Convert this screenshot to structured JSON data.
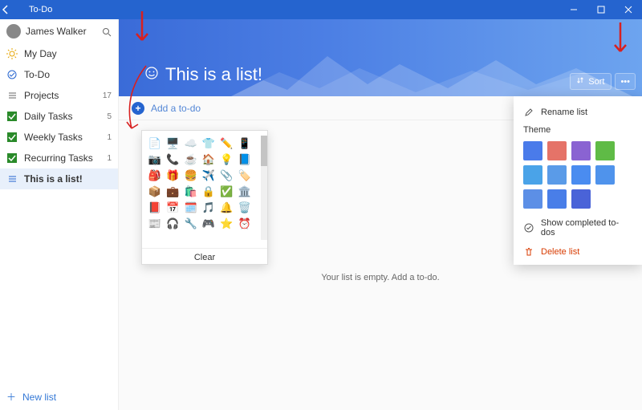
{
  "titlebar": {
    "title": "To-Do"
  },
  "profile": {
    "name": "James Walker"
  },
  "sidebar": {
    "items": [
      {
        "label": "My Day",
        "count": "",
        "kind": "myday"
      },
      {
        "label": "To-Do",
        "count": "",
        "kind": "todo"
      },
      {
        "label": "Projects",
        "count": "17",
        "kind": "list"
      },
      {
        "label": "Daily Tasks",
        "count": "5",
        "kind": "check"
      },
      {
        "label": "Weekly Tasks",
        "count": "1",
        "kind": "check"
      },
      {
        "label": "Recurring Tasks",
        "count": "1",
        "kind": "check"
      },
      {
        "label": "This is a list!",
        "count": "",
        "kind": "selected"
      }
    ],
    "new_list": "New list"
  },
  "hero": {
    "list_name": "This is a list!",
    "sort_label": "Sort"
  },
  "add": {
    "placeholder": "Add a to-do"
  },
  "empty": {
    "message": "Your list is empty. Add a to-do."
  },
  "emoji_popup": {
    "clear_label": "Clear"
  },
  "ctxmenu": {
    "rename": "Rename list",
    "theme": "Theme",
    "show_completed": "Show completed to-dos",
    "delete": "Delete list",
    "swatch_colors": [
      "#4a7bea",
      "#e57368",
      "#8a63d2",
      "#5fbb46",
      "#4aa3e8",
      "#5a9be8",
      "#4a8cf0",
      "#4f93ec",
      "#5c8fe6",
      "#497ee8",
      "#4a63d8"
    ]
  }
}
